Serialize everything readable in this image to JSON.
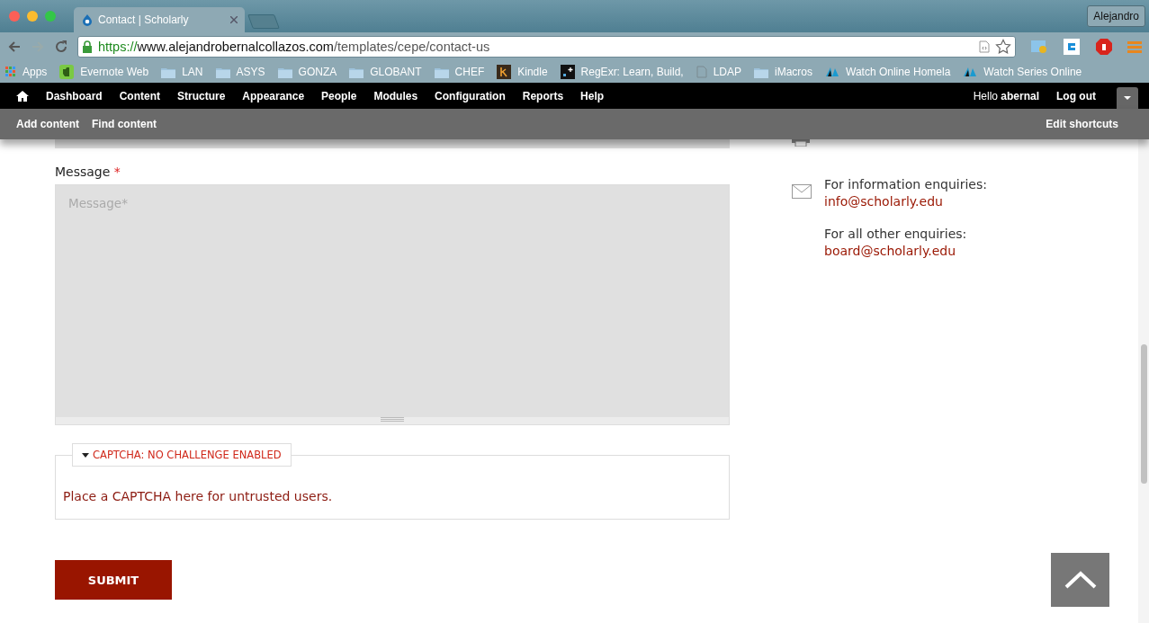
{
  "browser": {
    "tab_title": "Contact | Scholarly",
    "profile": "Alejandro",
    "url_scheme": "https://",
    "url_host": "www.alejandrobernalcollazos.com",
    "url_path": "/templates/cepe/contact-us",
    "bookmarks": [
      {
        "label": "Apps",
        "kind": "apps"
      },
      {
        "label": "Evernote Web",
        "kind": "evernote"
      },
      {
        "label": "LAN",
        "kind": "folder"
      },
      {
        "label": "ASYS",
        "kind": "folder"
      },
      {
        "label": "GONZA",
        "kind": "folder"
      },
      {
        "label": "GLOBANT",
        "kind": "folder"
      },
      {
        "label": "CHEF",
        "kind": "folder"
      },
      {
        "label": "Kindle",
        "kind": "kindle"
      },
      {
        "label": "RegExr: Learn, Build,",
        "kind": "regexr"
      },
      {
        "label": "LDAP",
        "kind": "page"
      },
      {
        "label": "iMacros",
        "kind": "folder"
      },
      {
        "label": "Watch Online Homela",
        "kind": "watch"
      },
      {
        "label": "Watch Series Online",
        "kind": "watch"
      }
    ]
  },
  "admin_menu": {
    "items": [
      "Dashboard",
      "Content",
      "Structure",
      "Appearance",
      "People",
      "Modules",
      "Configuration",
      "Reports",
      "Help"
    ],
    "greeting": "Hello **abernal**",
    "logout": "Log out"
  },
  "shortcuts": {
    "items": [
      "Add content",
      "Find content"
    ],
    "edit": "Edit shortcuts"
  },
  "form": {
    "message_label": "Message",
    "required_mark": "*",
    "message_placeholder": "Message*",
    "captcha_legend": "CAPTCHA: NO CHALLENGE ENABLED",
    "captcha_expanded": true,
    "captcha_text": "Place a CAPTCHA here for untrusted users.",
    "submit": "SUBMIT"
  },
  "contact": [
    {
      "label": "For information enquiries:",
      "email": "info@scholarly.edu"
    },
    {
      "label": "For all other enquiries:",
      "email": "board@scholarly.edu"
    }
  ]
}
